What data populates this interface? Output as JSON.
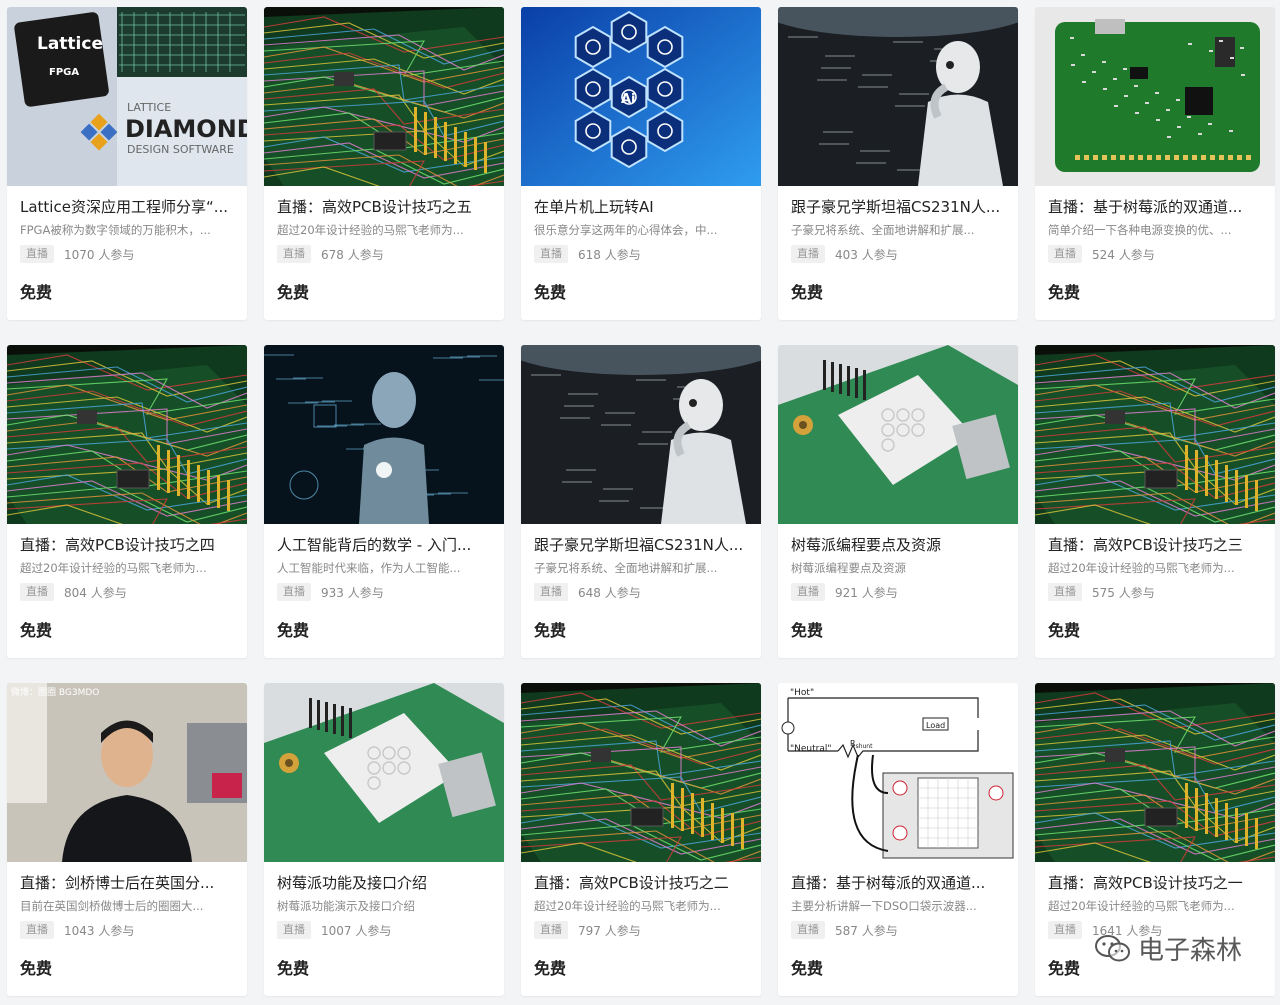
{
  "courses": [
    {
      "title": "Lattice资深应用工程师分享“...",
      "desc": "FPGA被称为数字领域的万能积木，...",
      "tag": "直播",
      "count": "1070 人参与",
      "price": "免费",
      "image": "lattice-diamond-banner",
      "thumb_text": [
        "Lattice",
        "FPGA",
        "LATTICE",
        "DIAMOND",
        "DESIGN SOFTWARE"
      ]
    },
    {
      "title": "直播：高效PCB设计技巧之五",
      "desc": "超过20年设计经验的马熙飞老师为...",
      "tag": "直播",
      "count": "678 人参与",
      "price": "免费",
      "image": "pcb-3d-render"
    },
    {
      "title": "在单片机上玩转AI",
      "desc": "很乐意分享这两年的心得体会，中...",
      "tag": "直播",
      "count": "618 人参与",
      "price": "免费",
      "image": "ai-hexagon-icons",
      "thumb_text": [
        "Ai"
      ]
    },
    {
      "title": "跟子豪兄学斯坦福CS231N人...",
      "desc": "子豪兄将系统、全面地讲解和扩展...",
      "tag": "直播",
      "count": "403 人参与",
      "price": "免费",
      "image": "robot-thinker-blackboard"
    },
    {
      "title": "直播：基于树莓派的双通道...",
      "desc": "简单介绍一下各种电源变换的优、...",
      "tag": "直播",
      "count": "524 人参与",
      "price": "免费",
      "image": "green-pcb-board"
    },
    {
      "title": "直播：高效PCB设计技巧之四",
      "desc": "超过20年设计经验的马熙飞老师为...",
      "tag": "直播",
      "count": "804 人参与",
      "price": "免费",
      "image": "pcb-3d-render"
    },
    {
      "title": "人工智能背后的数学 - 入门...",
      "desc": "人工智能时代来临，作为人工智能...",
      "tag": "直播",
      "count": "933 人参与",
      "price": "免费",
      "image": "robot-math-hologram"
    },
    {
      "title": "跟子豪兄学斯坦福CS231N人...",
      "desc": "子豪兄将系统、全面地讲解和扩展...",
      "tag": "直播",
      "count": "648 人参与",
      "price": "免费",
      "image": "robot-thinker-blackboard"
    },
    {
      "title": "树莓派编程要点及资源",
      "desc": "树莓派编程要点及资源",
      "tag": "直播",
      "count": "921 人参与",
      "price": "免费",
      "image": "raspberry-pi-closeup"
    },
    {
      "title": "直播：高效PCB设计技巧之三",
      "desc": "超过20年设计经验的马熙飞老师为...",
      "tag": "直播",
      "count": "575 人参与",
      "price": "免费",
      "image": "pcb-3d-render"
    },
    {
      "title": "直播：剑桥博士后在英国分...",
      "desc": "目前在英国剑桥做博士后的圈圈大...",
      "tag": "直播",
      "count": "1043 人参与",
      "price": "免费",
      "image": "presenter-webcam",
      "thumb_text": [
        "微博：圈圈 BG3MDO"
      ]
    },
    {
      "title": "树莓派功能及接口介绍",
      "desc": "树莓派功能演示及接口介绍",
      "tag": "直播",
      "count": "1007 人参与",
      "price": "免费",
      "image": "raspberry-pi-closeup"
    },
    {
      "title": "直播：高效PCB设计技巧之二",
      "desc": "超过20年设计经验的马熙飞老师为...",
      "tag": "直播",
      "count": "797 人参与",
      "price": "免费",
      "image": "pcb-3d-render"
    },
    {
      "title": "直播：基于树莓派的双通道...",
      "desc": "主要分析讲解一下DSO口袋示波器...",
      "tag": "直播",
      "count": "587 人参与",
      "price": "免费",
      "image": "oscilloscope-circuit-diagram",
      "thumb_text": [
        "\"Hot\"",
        "\"Neutral\"",
        "Load",
        "R",
        "shunt"
      ]
    },
    {
      "title": "直播：高效PCB设计技巧之一",
      "desc": "超过20年设计经验的马熙飞老师为...",
      "tag": "直播",
      "count": "1641 人参与",
      "price": "免费",
      "image": "pcb-3d-render"
    }
  ],
  "watermark": {
    "text": "电子森林",
    "icon": "wechat-icon"
  }
}
